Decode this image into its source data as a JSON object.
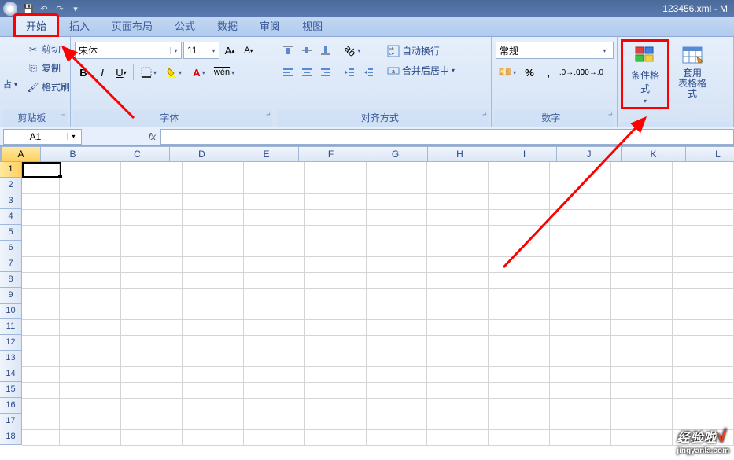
{
  "title": "123456.xml - M",
  "tabs": [
    "开始",
    "插入",
    "页面布局",
    "公式",
    "数据",
    "审阅",
    "视图"
  ],
  "active_tab_index": 0,
  "clipboard": {
    "cut": "剪切",
    "copy": "复制",
    "format_painter": "格式刷",
    "label": "剪贴板"
  },
  "font": {
    "family": "宋体",
    "size": "11",
    "label": "字体"
  },
  "alignment": {
    "wrap": "自动换行",
    "merge": "合并后居中",
    "label": "对齐方式"
  },
  "number": {
    "format": "常规",
    "label": "数字"
  },
  "styles": {
    "conditional": "条件格式",
    "table": "套用\n表格格式"
  },
  "name_box": "A1",
  "fx_label": "fx",
  "columns": [
    "A",
    "B",
    "C",
    "D",
    "E",
    "F",
    "G",
    "H",
    "I",
    "J",
    "K",
    "L"
  ],
  "selected_col": 0,
  "rows": 18,
  "selected_row": 0,
  "watermark": {
    "main": "经验啦",
    "check": "√",
    "sub": "jingyanla.com"
  }
}
